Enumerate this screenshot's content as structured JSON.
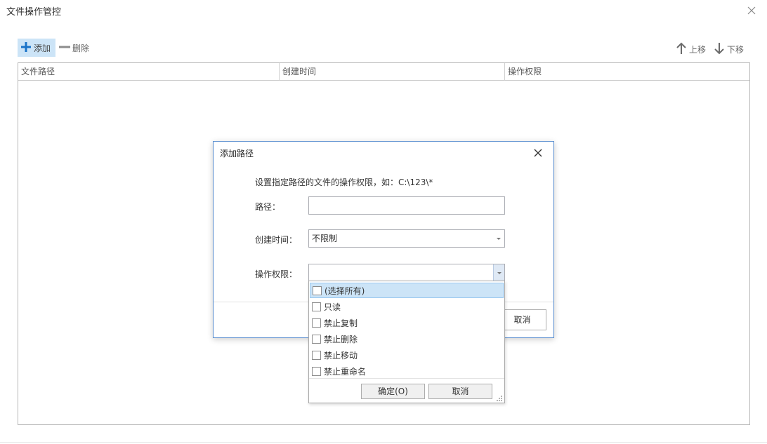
{
  "window": {
    "title": "文件操作管控"
  },
  "toolbar": {
    "add_label": "添加",
    "delete_label": "删除",
    "up_label": "上移",
    "down_label": "下移"
  },
  "grid": {
    "columns": [
      "文件路径",
      "创建时间",
      "操作权限"
    ],
    "rows": []
  },
  "dialog": {
    "title": "添加路径",
    "hint": "设置指定路径的文件的操作权限，如：C:\\123\\*",
    "path_label": "路径：",
    "path_value": "",
    "time_label": "创建时间：",
    "time_value": "不限制",
    "perm_label": "操作权限：",
    "perm_value": "",
    "cancel_label": "取消"
  },
  "dropdown": {
    "items": [
      {
        "label": "(选择所有)",
        "checked": false
      },
      {
        "label": "只读",
        "checked": false
      },
      {
        "label": "禁止复制",
        "checked": false
      },
      {
        "label": "禁止删除",
        "checked": false
      },
      {
        "label": "禁止移动",
        "checked": false
      },
      {
        "label": "禁止重命名",
        "checked": false
      }
    ],
    "ok_label": "确定(O)",
    "cancel_label": "取消"
  },
  "colors": {
    "accent": "#1a73c8",
    "selection": "#cce4f7",
    "dialog_border": "#5b8fd0"
  }
}
